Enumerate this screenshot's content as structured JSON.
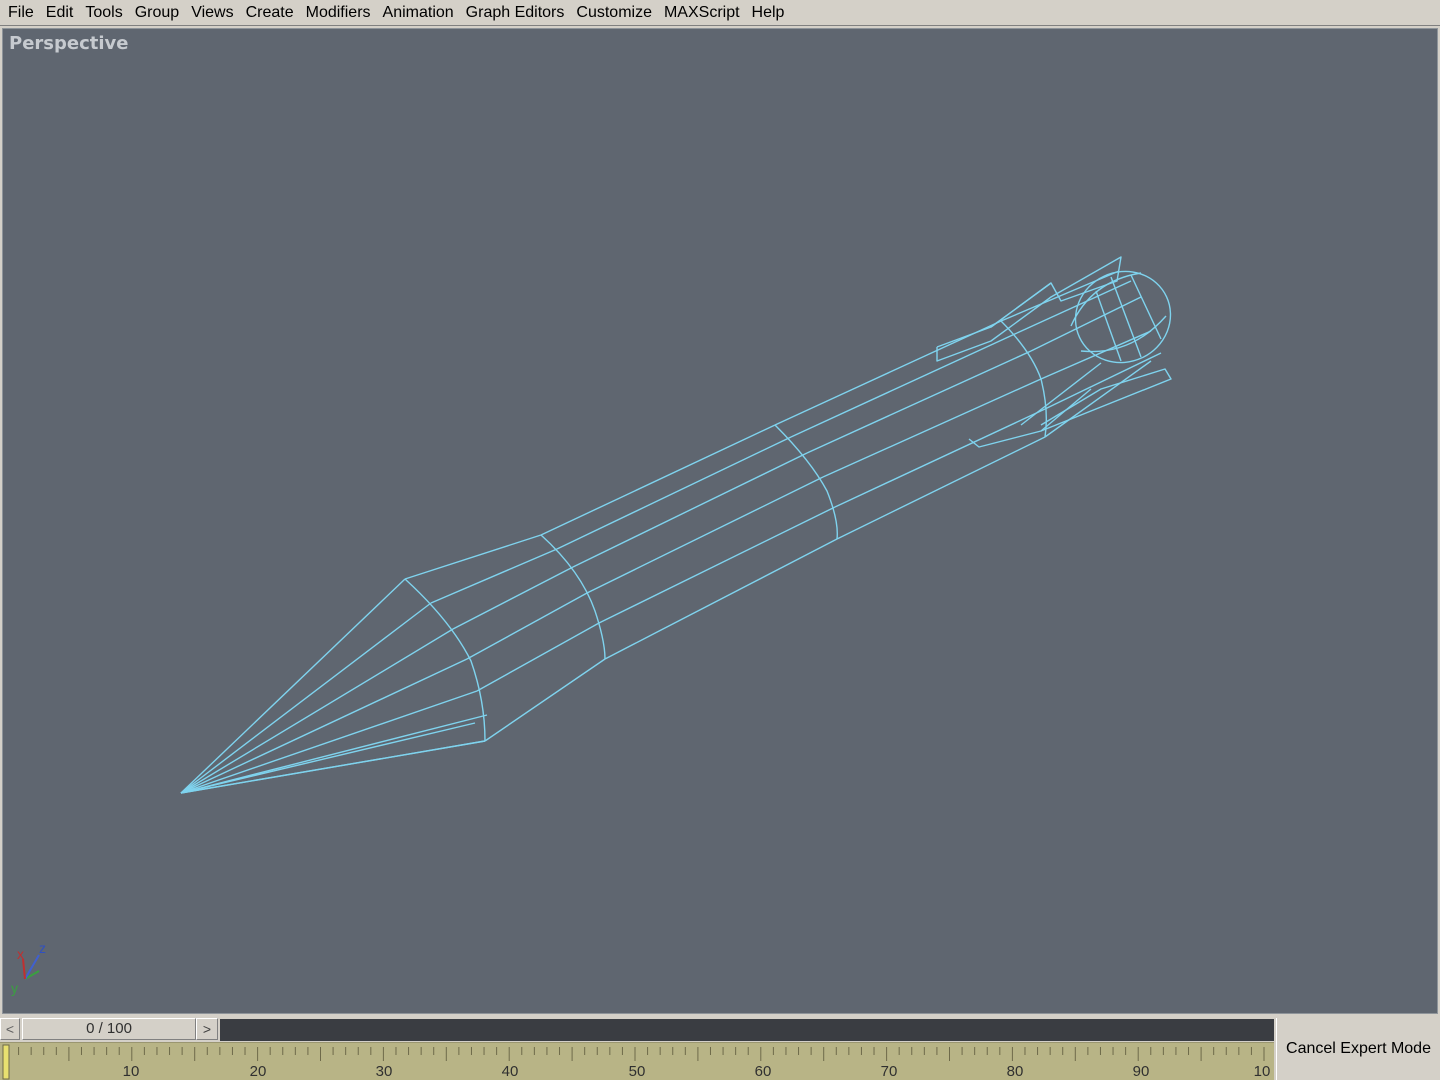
{
  "menu": [
    {
      "label": "File"
    },
    {
      "label": "Edit"
    },
    {
      "label": "Tools"
    },
    {
      "label": "Group"
    },
    {
      "label": "Views"
    },
    {
      "label": "Create"
    },
    {
      "label": "Modifiers"
    },
    {
      "label": "Animation"
    },
    {
      "label": "Graph Editors"
    },
    {
      "label": "Customize"
    },
    {
      "label": "MAXScript"
    },
    {
      "label": "Help"
    }
  ],
  "viewport": {
    "label": "Perspective",
    "wire_color": "#7fd3ee",
    "background_color": "#5f6670",
    "axis_labels": {
      "x": "x",
      "y": "y",
      "z": "z"
    }
  },
  "timeline": {
    "slider_text": "0 / 100",
    "left_button": "<",
    "right_button": ">",
    "ruler_labels": [
      "10",
      "20",
      "30",
      "40",
      "50",
      "60",
      "70",
      "80",
      "90",
      "10"
    ]
  },
  "expert_mode": {
    "label": "Cancel Expert Mode"
  }
}
